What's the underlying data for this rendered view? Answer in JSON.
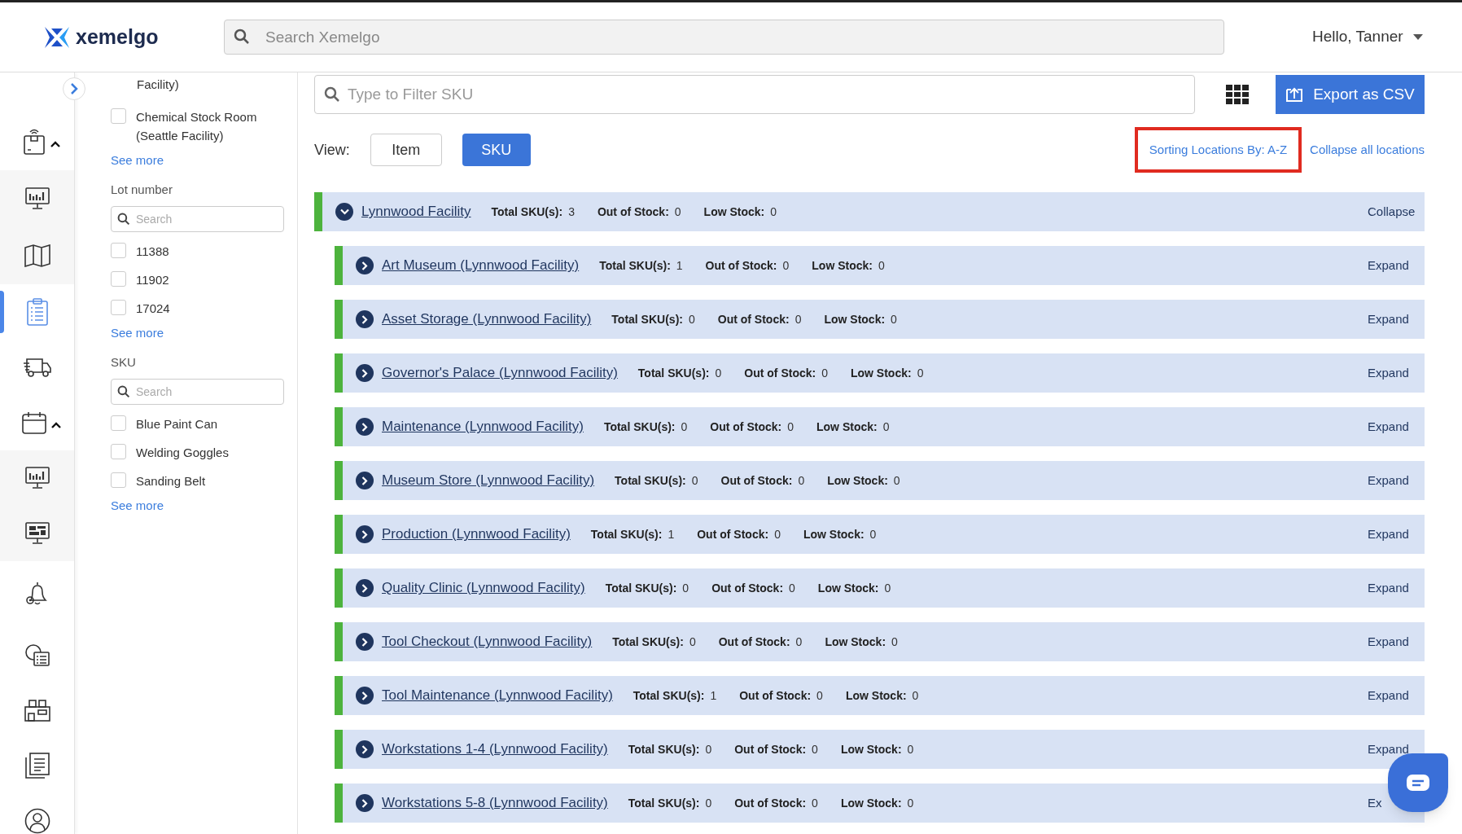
{
  "header": {
    "logo": "xemelgo",
    "search": {
      "placeholder": "Search Xemelgo"
    },
    "user": "Hello, Tanner"
  },
  "nav": [
    {
      "kind": "group",
      "expanded": true,
      "selected": false
    },
    {
      "kind": "sub",
      "selected": false
    },
    {
      "kind": "sub",
      "selected": false
    },
    {
      "kind": "item",
      "selected": true
    },
    {
      "kind": "item",
      "selected": false
    },
    {
      "kind": "group",
      "expanded": true,
      "selected": false
    },
    {
      "kind": "sub",
      "selected": false
    },
    {
      "kind": "sub",
      "selected": false
    },
    {
      "kind": "item",
      "selected": false
    },
    {
      "kind": "item",
      "selected": false
    },
    {
      "kind": "item",
      "selected": false
    },
    {
      "kind": "item",
      "selected": false
    },
    {
      "kind": "item",
      "selected": false
    }
  ],
  "filters": [
    {
      "options": [
        {
          "label": "Facility)",
          "kind": "cut"
        },
        {
          "label": "Chemical Stock Room (Seattle Facility)",
          "kind": "option",
          "checked": false
        }
      ],
      "see_more": "See more"
    },
    {
      "title": "Lot number",
      "search": {
        "placeholder": "Search"
      },
      "options": [
        {
          "label": "11388",
          "kind": "option",
          "checked": false
        },
        {
          "label": "11902",
          "kind": "option",
          "checked": false
        },
        {
          "label": "17024",
          "kind": "option",
          "checked": false
        }
      ],
      "see_more": "See more"
    },
    {
      "title": "SKU",
      "search": {
        "placeholder": "Search"
      },
      "options": [
        {
          "label": "Blue Paint Can",
          "kind": "option",
          "checked": false
        },
        {
          "label": "Welding Goggles",
          "kind": "option",
          "checked": false
        },
        {
          "label": "Sanding Belt",
          "kind": "option",
          "checked": false
        }
      ],
      "see_more": "See more"
    }
  ],
  "toolbar": {
    "filter": {
      "placeholder": "Type to Filter SKU"
    },
    "export_button": "Export as CSV"
  },
  "view": {
    "label": "View:",
    "options": [
      {
        "label": "Item",
        "selected": false
      },
      {
        "label": "SKU",
        "selected": true
      }
    ]
  },
  "sort_link": {
    "label": "Sorting Locations By: A-Z",
    "highlighted": true
  },
  "collapse_all": "Collapse all locations",
  "locations": [
    {
      "name": "Lynnwood Facility",
      "expanded": true,
      "total_label": "Total SKU(s):",
      "total": "3",
      "out_label": "Out of Stock:",
      "out": "0",
      "low_label": "Low Stock:",
      "low": "0",
      "action": "Collapse",
      "children": [
        {
          "name": "Art Museum (Lynnwood Facility)",
          "expanded": false,
          "total_label": "Total SKU(s):",
          "total": "1",
          "out_label": "Out of Stock:",
          "out": "0",
          "low_label": "Low Stock:",
          "low": "0",
          "action": "Expand"
        },
        {
          "name": "Asset Storage (Lynnwood Facility)",
          "expanded": false,
          "total_label": "Total SKU(s):",
          "total": "0",
          "out_label": "Out of Stock:",
          "out": "0",
          "low_label": "Low Stock:",
          "low": "0",
          "action": "Expand"
        },
        {
          "name": "Governor's Palace (Lynnwood Facility)",
          "expanded": false,
          "total_label": "Total SKU(s):",
          "total": "0",
          "out_label": "Out of Stock:",
          "out": "0",
          "low_label": "Low Stock:",
          "low": "0",
          "action": "Expand"
        },
        {
          "name": "Maintenance (Lynnwood Facility)",
          "expanded": false,
          "total_label": "Total SKU(s):",
          "total": "0",
          "out_label": "Out of Stock:",
          "out": "0",
          "low_label": "Low Stock:",
          "low": "0",
          "action": "Expand"
        },
        {
          "name": "Museum Store (Lynnwood Facility)",
          "expanded": false,
          "total_label": "Total SKU(s):",
          "total": "0",
          "out_label": "Out of Stock:",
          "out": "0",
          "low_label": "Low Stock:",
          "low": "0",
          "action": "Expand"
        },
        {
          "name": "Production (Lynnwood Facility)",
          "expanded": false,
          "total_label": "Total SKU(s):",
          "total": "1",
          "out_label": "Out of Stock:",
          "out": "0",
          "low_label": "Low Stock:",
          "low": "0",
          "action": "Expand"
        },
        {
          "name": "Quality Clinic (Lynnwood Facility)",
          "expanded": false,
          "total_label": "Total SKU(s):",
          "total": "0",
          "out_label": "Out of Stock:",
          "out": "0",
          "low_label": "Low Stock:",
          "low": "0",
          "action": "Expand"
        },
        {
          "name": "Tool Checkout (Lynnwood Facility)",
          "expanded": false,
          "total_label": "Total SKU(s):",
          "total": "0",
          "out_label": "Out of Stock:",
          "out": "0",
          "low_label": "Low Stock:",
          "low": "0",
          "action": "Expand"
        },
        {
          "name": "Tool Maintenance (Lynnwood Facility)",
          "expanded": false,
          "total_label": "Total SKU(s):",
          "total": "1",
          "out_label": "Out of Stock:",
          "out": "0",
          "low_label": "Low Stock:",
          "low": "0",
          "action": "Expand"
        },
        {
          "name": "Workstations 1-4 (Lynnwood Facility)",
          "expanded": false,
          "total_label": "Total SKU(s):",
          "total": "0",
          "out_label": "Out of Stock:",
          "out": "0",
          "low_label": "Low Stock:",
          "low": "0",
          "action": "Expand"
        },
        {
          "name": "Workstations 5-8 (Lynnwood Facility)",
          "expanded": false,
          "total_label": "Total SKU(s):",
          "total": "0",
          "out_label": "Out of Stock:",
          "out": "0",
          "low_label": "Low Stock:",
          "low": "0",
          "action": "Ex"
        }
      ]
    }
  ]
}
